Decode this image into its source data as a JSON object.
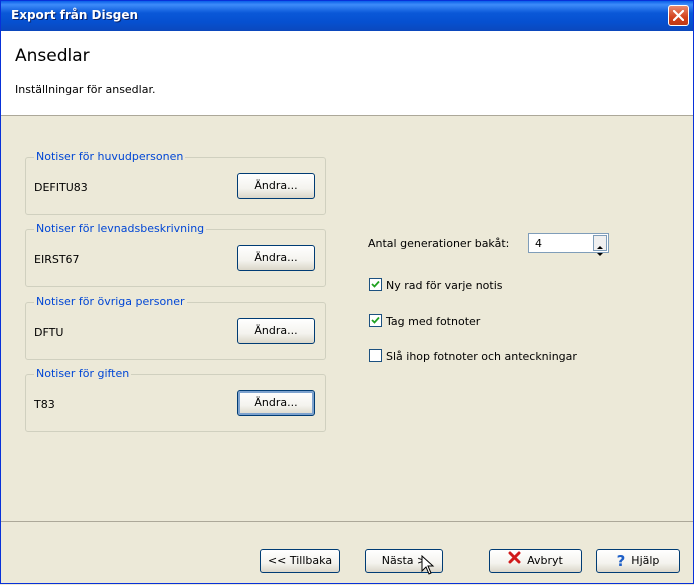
{
  "window": {
    "title": "Export från Disgen"
  },
  "header": {
    "title": "Ansedlar",
    "subtitle": "Inställningar för ansedlar."
  },
  "groups": [
    {
      "legend": "Notiser för huvudpersonen",
      "value": "DEFITU83",
      "button": "Ändra..."
    },
    {
      "legend": "Notiser för levnadsbeskrivning",
      "value": "EIRST67",
      "button": "Ändra..."
    },
    {
      "legend": "Notiser för övriga personer",
      "value": "DFTU",
      "button": "Ändra..."
    },
    {
      "legend": "Notiser för giften",
      "value": "T83",
      "button": "Ändra..."
    }
  ],
  "generations": {
    "label": "Antal generationer bakåt:",
    "value": "4"
  },
  "options": [
    {
      "label": "Ny rad för varje notis",
      "checked": true
    },
    {
      "label": "Tag med fotnoter",
      "checked": true
    },
    {
      "label": "Slå ihop fotnoter och anteckningar",
      "checked": false
    }
  ],
  "footer": {
    "back": "<< Tillbaka",
    "next": "Nästa >",
    "cancel": "Avbryt",
    "help": "Hjälp"
  },
  "icons": {
    "close": "close-icon",
    "cancel": "red-x-icon",
    "help": "question-mark-icon",
    "cursor": "mouse-cursor-icon"
  },
  "colors": {
    "titlebar": "#0A58D8",
    "legend": "#0046D5",
    "dialog_bg": "#ECE9D8"
  }
}
